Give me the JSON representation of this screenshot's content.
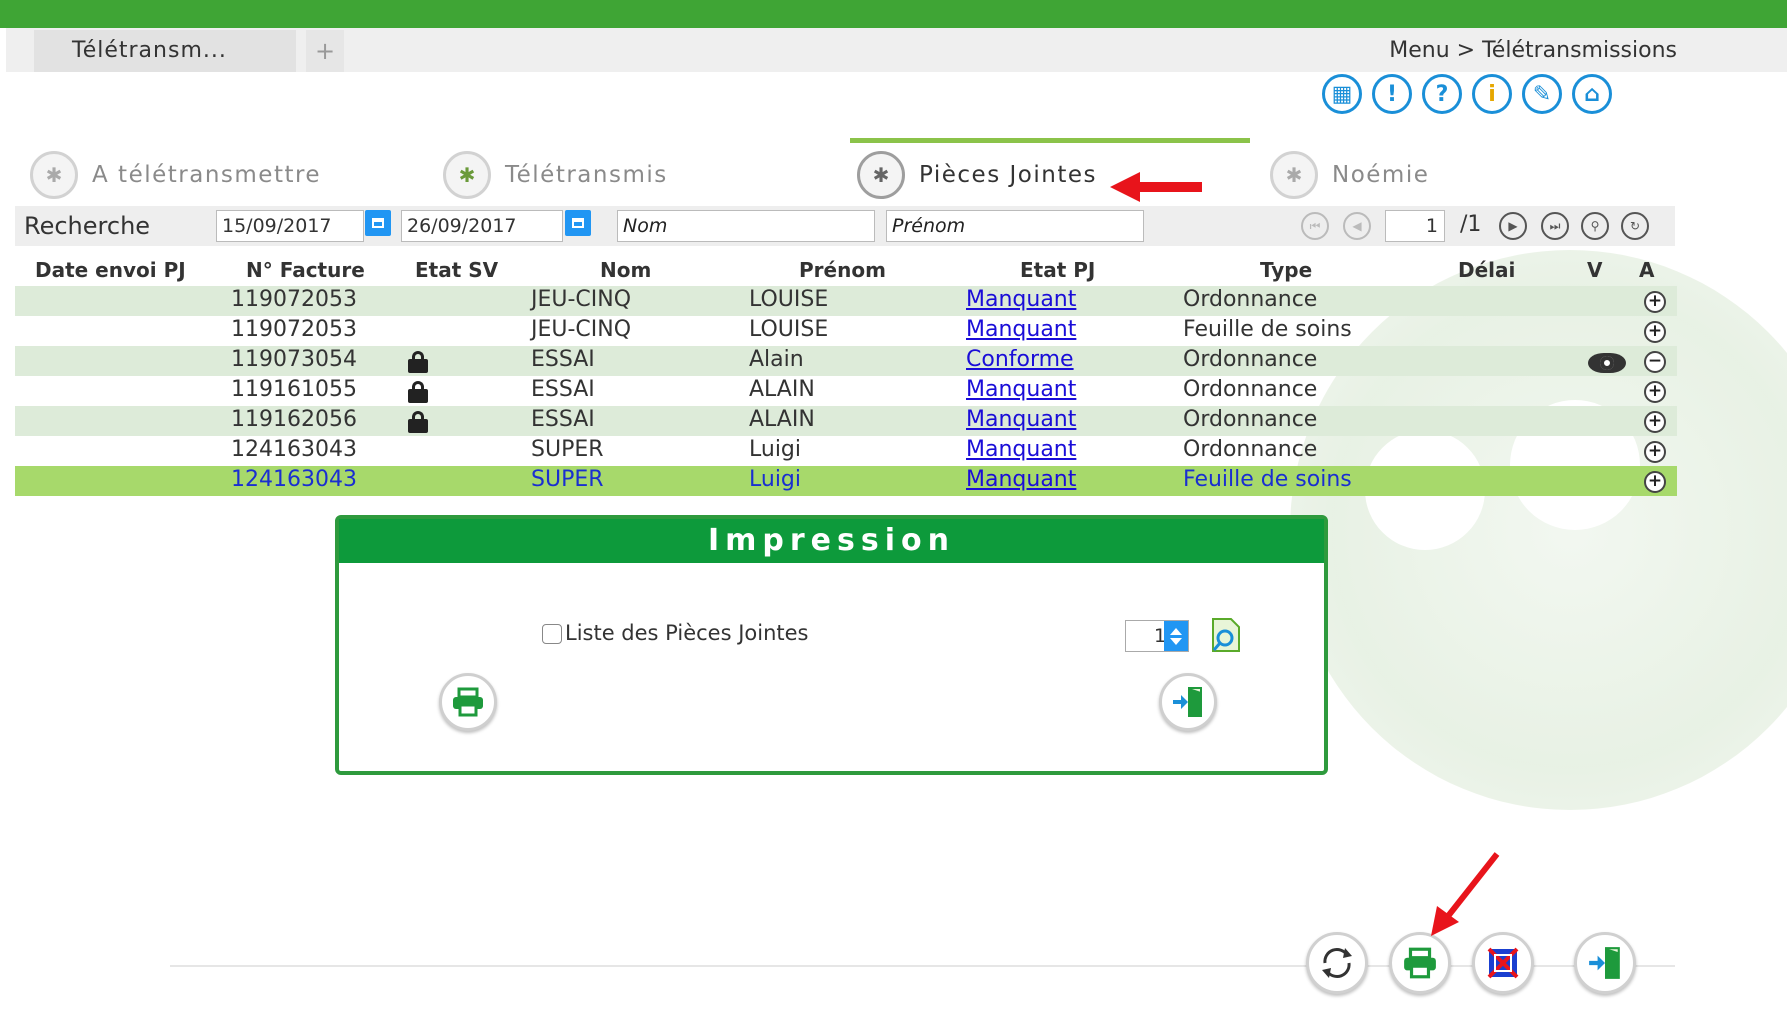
{
  "app": {
    "tab_title": "Télétransm...",
    "tab_add": "+",
    "breadcrumb": "Menu > Télétransmissions"
  },
  "toolbar": {
    "icons": [
      "calendar-icon",
      "alert-icon",
      "help-icon",
      "info-icon",
      "settings-icon",
      "home-icon"
    ],
    "icon_glyphs": [
      "▦",
      "!",
      "?",
      "i",
      "✎",
      "⌂"
    ]
  },
  "tabs": [
    {
      "label": "A télétransmettre",
      "active": false
    },
    {
      "label": "Télétransmis",
      "active": false
    },
    {
      "label": "Pièces Jointes",
      "active": true
    },
    {
      "label": "Noémie",
      "active": false
    }
  ],
  "search": {
    "label": "Recherche",
    "date_from": "15/09/2017",
    "date_to": "26/09/2017",
    "nom_placeholder": "Nom",
    "prenom_placeholder": "Prénom",
    "page_current": "1",
    "page_total": "/1"
  },
  "grid": {
    "columns": [
      "Date envoi PJ",
      "N° Facture",
      "Etat SV",
      "Nom",
      "Prénom",
      "Etat PJ",
      "Type",
      "Délai",
      "V",
      "A"
    ],
    "rows": [
      {
        "facture": "119072053",
        "locked": false,
        "nom": "JEU-CINQ",
        "prenom": "LOUISE",
        "etat_pj": "Manquant",
        "type": "Ordonnance",
        "viewable": false,
        "action": "+"
      },
      {
        "facture": "119072053",
        "locked": false,
        "nom": "JEU-CINQ",
        "prenom": "LOUISE",
        "etat_pj": "Manquant",
        "type": "Feuille de soins",
        "viewable": false,
        "action": "+"
      },
      {
        "facture": "119073054",
        "locked": true,
        "nom": "ESSAI",
        "prenom": "Alain",
        "etat_pj": "Conforme",
        "type": "Ordonnance",
        "viewable": true,
        "action": "−"
      },
      {
        "facture": "119161055",
        "locked": true,
        "nom": "ESSAI",
        "prenom": "ALAIN",
        "etat_pj": "Manquant",
        "type": "Ordonnance",
        "viewable": false,
        "action": "+"
      },
      {
        "facture": "119162056",
        "locked": true,
        "nom": "ESSAI",
        "prenom": "ALAIN",
        "etat_pj": "Manquant",
        "type": "Ordonnance",
        "viewable": false,
        "action": "+"
      },
      {
        "facture": "124163043",
        "locked": false,
        "nom": "SUPER",
        "prenom": "Luigi",
        "etat_pj": "Manquant",
        "type": "Ordonnance",
        "viewable": false,
        "action": "+"
      },
      {
        "facture": "124163043",
        "locked": false,
        "nom": "SUPER",
        "prenom": "Luigi",
        "etat_pj": "Manquant",
        "type": "Feuille de soins",
        "viewable": false,
        "action": "+",
        "selected": true
      }
    ]
  },
  "impression": {
    "title": "Impression",
    "checkbox_label": "Liste des Pièces Jointes",
    "checked": false,
    "copies": "1"
  },
  "footer": {
    "buttons": [
      "refresh-button",
      "print-button",
      "transmit-button",
      "exit-button"
    ]
  },
  "colors": {
    "brand_green": "#3fa535",
    "header_green": "#0d9a3b",
    "row_alt": "#ddebd9",
    "row_selected": "#a7d96b",
    "link_blue": "#1a0dd8",
    "accent_blue": "#2196f3",
    "annotation_red": "#e8141b"
  }
}
